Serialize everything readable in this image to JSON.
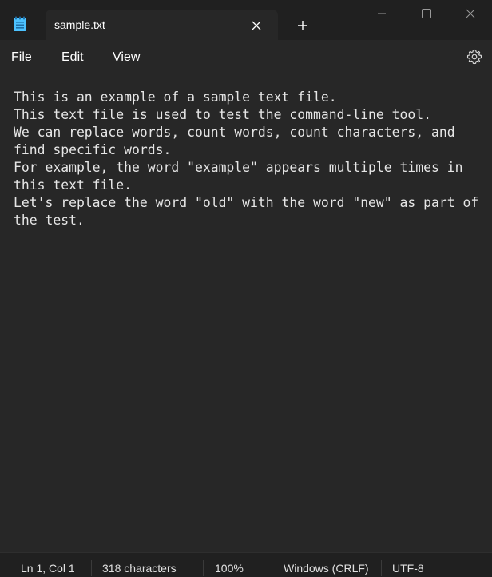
{
  "titlebar": {
    "app_icon": "notepad-icon",
    "tab_title": "sample.txt",
    "tab_close_icon": "close-icon",
    "new_tab_icon": "plus-icon",
    "minimize_icon": "minimize-icon",
    "maximize_icon": "maximize-icon",
    "window_close_icon": "close-icon"
  },
  "menu": {
    "items": [
      "File",
      "Edit",
      "View"
    ],
    "settings_icon": "gear-icon"
  },
  "editor": {
    "content": "This is an example of a sample text file.\nThis text file is used to test the command-line tool.\nWe can replace words, count words, count characters, and\nfind specific words.\nFor example, the word \"example\" appears multiple times in\nthis text file.\nLet's replace the word \"old\" with the word \"new\" as part of\nthe test."
  },
  "status": {
    "position": "Ln 1, Col 1",
    "characters": "318 characters",
    "zoom": "100%",
    "line_ending": "Windows (CRLF)",
    "encoding": "UTF-8"
  },
  "colors": {
    "background": "#272727",
    "titlebar": "#202020",
    "text": "#e6e6e6",
    "icon_accent": "#4cc2ff"
  }
}
